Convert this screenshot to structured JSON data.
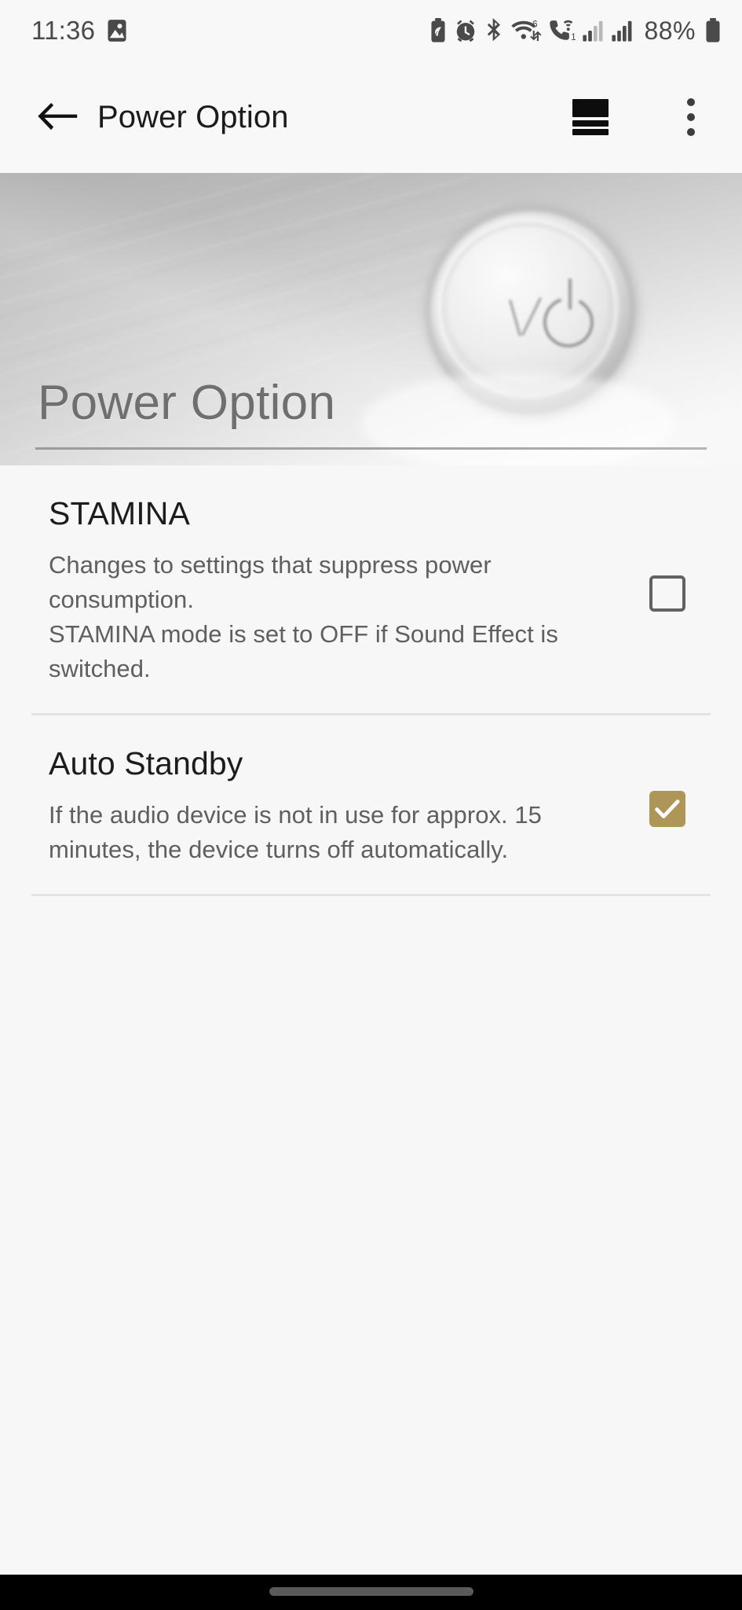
{
  "status_bar": {
    "time": "11:36",
    "left_icons": [
      "image-notification-icon"
    ],
    "right_icons": [
      "battery-saver-icon",
      "alarm-icon",
      "bluetooth-icon",
      "wifi-6-data-icon",
      "wifi-calling-icon",
      "signal-sim1-icon",
      "signal-sim2-icon"
    ],
    "battery_percent": "88%",
    "battery_icon": "battery-full-icon",
    "text_color": "#4a4a4a"
  },
  "app_bar": {
    "back_icon": "back-arrow-icon",
    "title": "Power Option",
    "stack_icon": "stacked-bars-icon",
    "overflow_icon": "overflow-menu-icon",
    "background": "#f8f8f8"
  },
  "hero": {
    "title": "Power Option",
    "image_name": "power-button-photo",
    "image_alt": "Brushed metal surface with a round power button"
  },
  "settings": {
    "items": [
      {
        "name": "stamina",
        "title": "STAMINA",
        "description": "Changes to settings that suppress power consumption.\nSTAMINA mode is set to OFF if Sound Effect is switched.",
        "checked": false,
        "checkbox_state": "unchecked"
      },
      {
        "name": "auto-standby",
        "title": "Auto Standby",
        "description": "If the audio device is not in use for approx. 15 minutes, the device turns off automatically.",
        "checked": true,
        "checkbox_state": "checked"
      }
    ]
  },
  "colors": {
    "accent_gold": "#ad9657",
    "page_background": "#f7f7f7",
    "divider": "#e3e3e3",
    "hero_rule": "#9a9a9a",
    "title_text": "#1c1c1c",
    "description_text": "#5f5f5f",
    "hero_title_text": "#6f6f6f"
  },
  "nav_bar": {
    "gesture_pill": "home-gesture-pill",
    "background": "#000000"
  }
}
